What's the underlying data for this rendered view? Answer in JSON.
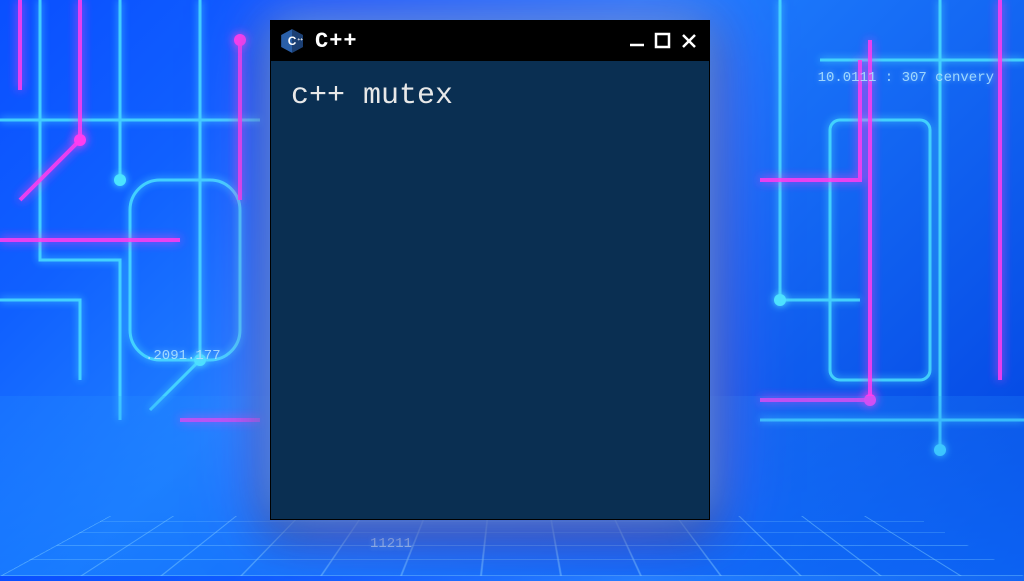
{
  "window": {
    "title": "C++",
    "body_text": "c++ mutex"
  },
  "decorations": {
    "top_right": "10.0111 : 307  cenvery",
    "mid_left": ".2091.177",
    "bottom": "11211"
  },
  "colors": {
    "body_bg": "#0a2f52",
    "titlebar_bg": "#000000",
    "neon_cyan": "#4be4ff",
    "neon_pink": "#ff3cf0"
  }
}
